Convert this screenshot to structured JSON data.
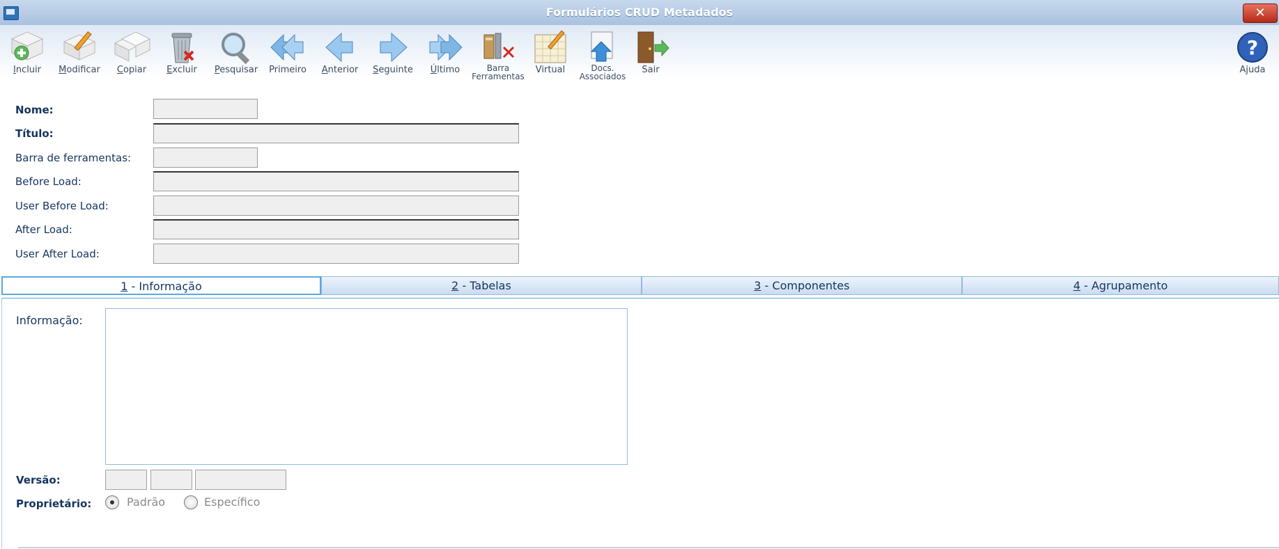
{
  "window": {
    "title": "Formulários CRUD Metadados",
    "close_glyph": "✕"
  },
  "toolbar": {
    "items": [
      {
        "label": "Incluir",
        "icon": "add-document-icon"
      },
      {
        "label": "Modificar",
        "icon": "edit-document-icon"
      },
      {
        "label": "Copiar",
        "icon": "copy-document-icon"
      },
      {
        "label": "Excluir",
        "icon": "trash-icon"
      },
      {
        "label": "Pesquisar",
        "icon": "magnifier-icon"
      },
      {
        "label": "Primeiro",
        "icon": "first-arrow-icon"
      },
      {
        "label": "Anterior",
        "icon": "previous-arrow-icon"
      },
      {
        "label": "Seguinte",
        "icon": "next-arrow-icon"
      },
      {
        "label": "Último",
        "icon": "last-arrow-icon"
      },
      {
        "label": "Barra\nFerramentas",
        "icon": "toolbar-tools-icon"
      },
      {
        "label": "Virtual",
        "icon": "virtual-pad-icon"
      },
      {
        "label": "Docs.\nAssociados",
        "icon": "associated-docs-icon"
      },
      {
        "label": "Sair",
        "icon": "exit-door-icon"
      }
    ],
    "help_label": "Ajuda",
    "help_icon": "help-icon"
  },
  "form": {
    "nome_label": "Nome:",
    "titulo_label": "Título:",
    "barra_label": "Barra de ferramentas:",
    "before_load_label": "Before Load:",
    "user_before_load_label": "User Before Load:",
    "after_load_label": "After Load:",
    "user_after_load_label": "User After Load:"
  },
  "tabs": [
    {
      "key": "1",
      "rest": " - Informação"
    },
    {
      "key": "2",
      "rest": " - Tabelas"
    },
    {
      "key": "3",
      "rest": " - Componentes"
    },
    {
      "key": "4",
      "rest": " - Agrupamento"
    }
  ],
  "panel": {
    "informacao_label": "Informação:",
    "versao_label": "Versão:",
    "proprietario_label": "Proprietário:",
    "radio_padrao": "Padrão",
    "radio_especifico": "Específico"
  },
  "colors": {
    "accent": "#59a8df",
    "label": "#15355e",
    "titlebar": "#a9c2e0",
    "close": "#c0392b"
  }
}
